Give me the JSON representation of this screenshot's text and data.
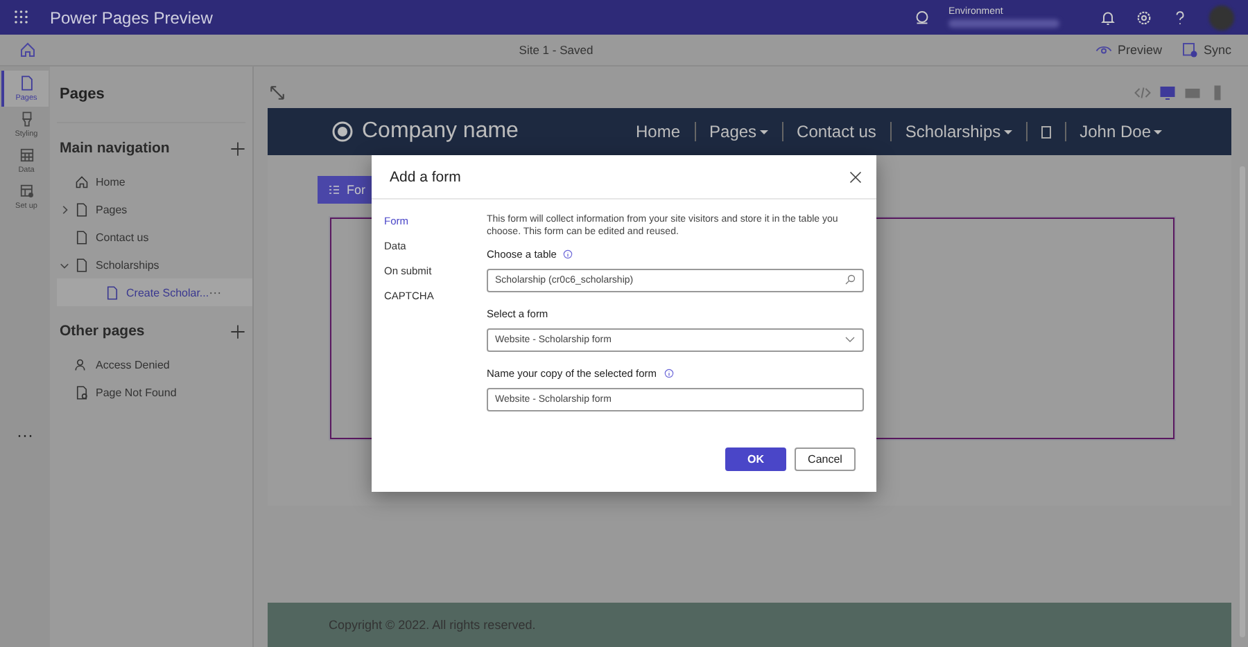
{
  "app": {
    "title": "Power Pages Preview",
    "environment_label": "Environment"
  },
  "toolbar": {
    "status": "Site 1 - Saved",
    "actions": [
      {
        "label": "Preview",
        "kind": "eye"
      },
      {
        "label": "Sync",
        "kind": "sync"
      }
    ]
  },
  "rail": {
    "items": [
      {
        "label": "Pages",
        "kind": "page",
        "selected": true
      },
      {
        "label": "Styling",
        "kind": "brush",
        "selected": false
      },
      {
        "label": "Data",
        "kind": "table",
        "selected": false
      },
      {
        "label": "Set up",
        "kind": "setup",
        "selected": false
      }
    ],
    "more": "···"
  },
  "pages_panel": {
    "title": "Pages",
    "sections": [
      {
        "title": "Main navigation",
        "items": [
          {
            "label": "Home",
            "kind": "home",
            "selected": false
          },
          {
            "label": "Pages",
            "kind": "page",
            "selected": false,
            "expanded": false
          },
          {
            "label": "Contact us",
            "kind": "page",
            "selected": false
          },
          {
            "label": "Scholarships",
            "kind": "page",
            "selected": false,
            "expanded": true,
            "children": [
              {
                "label": "Create Scholar...",
                "kind": "page",
                "selected": true,
                "more": "···"
              }
            ]
          }
        ]
      },
      {
        "title": "Other pages",
        "items": [
          {
            "label": "Access Denied",
            "kind": "person",
            "selected": false
          },
          {
            "label": "Page Not Found",
            "kind": "page-error",
            "selected": false
          }
        ]
      }
    ]
  },
  "preview": {
    "devices": [
      {
        "kind": "code",
        "selected": false
      },
      {
        "kind": "desktop",
        "selected": true
      },
      {
        "kind": "tablet",
        "selected": false
      },
      {
        "kind": "phone",
        "selected": false
      }
    ],
    "site": {
      "brand": "Company name",
      "nav": [
        {
          "label": "Home",
          "dropdown": false
        },
        {
          "label": "Pages",
          "dropdown": true
        },
        {
          "label": "Contact us",
          "dropdown": false
        },
        {
          "label": "Scholarships",
          "dropdown": true
        },
        {
          "kind": "search"
        },
        {
          "label": "John Doe",
          "dropdown": true
        }
      ],
      "form_button": "For",
      "footer": "Copyright © 2022. All rights reserved."
    }
  },
  "dialog": {
    "title": "Add a form",
    "nav": [
      {
        "label": "Form",
        "selected": true
      },
      {
        "label": "Data",
        "selected": false
      },
      {
        "label": "On submit",
        "selected": false
      },
      {
        "label": "CAPTCHA",
        "selected": false
      }
    ],
    "description": "This form will collect information from your site visitors and store it in the table you choose. This form can be edited and reused.",
    "fields": [
      {
        "label": "Choose a table",
        "kind": "search",
        "value": "Scholarship (cr0c6_scholarship)",
        "info": true
      },
      {
        "label": "Select a form",
        "kind": "select",
        "value": "Website - Scholarship form",
        "info": false
      },
      {
        "label": "Name your copy of the selected form",
        "kind": "text",
        "value": "Website - Scholarship form",
        "info": true
      }
    ],
    "buttons": [
      {
        "label": "OK",
        "primary": true
      },
      {
        "label": "Cancel",
        "primary": false
      }
    ]
  }
}
